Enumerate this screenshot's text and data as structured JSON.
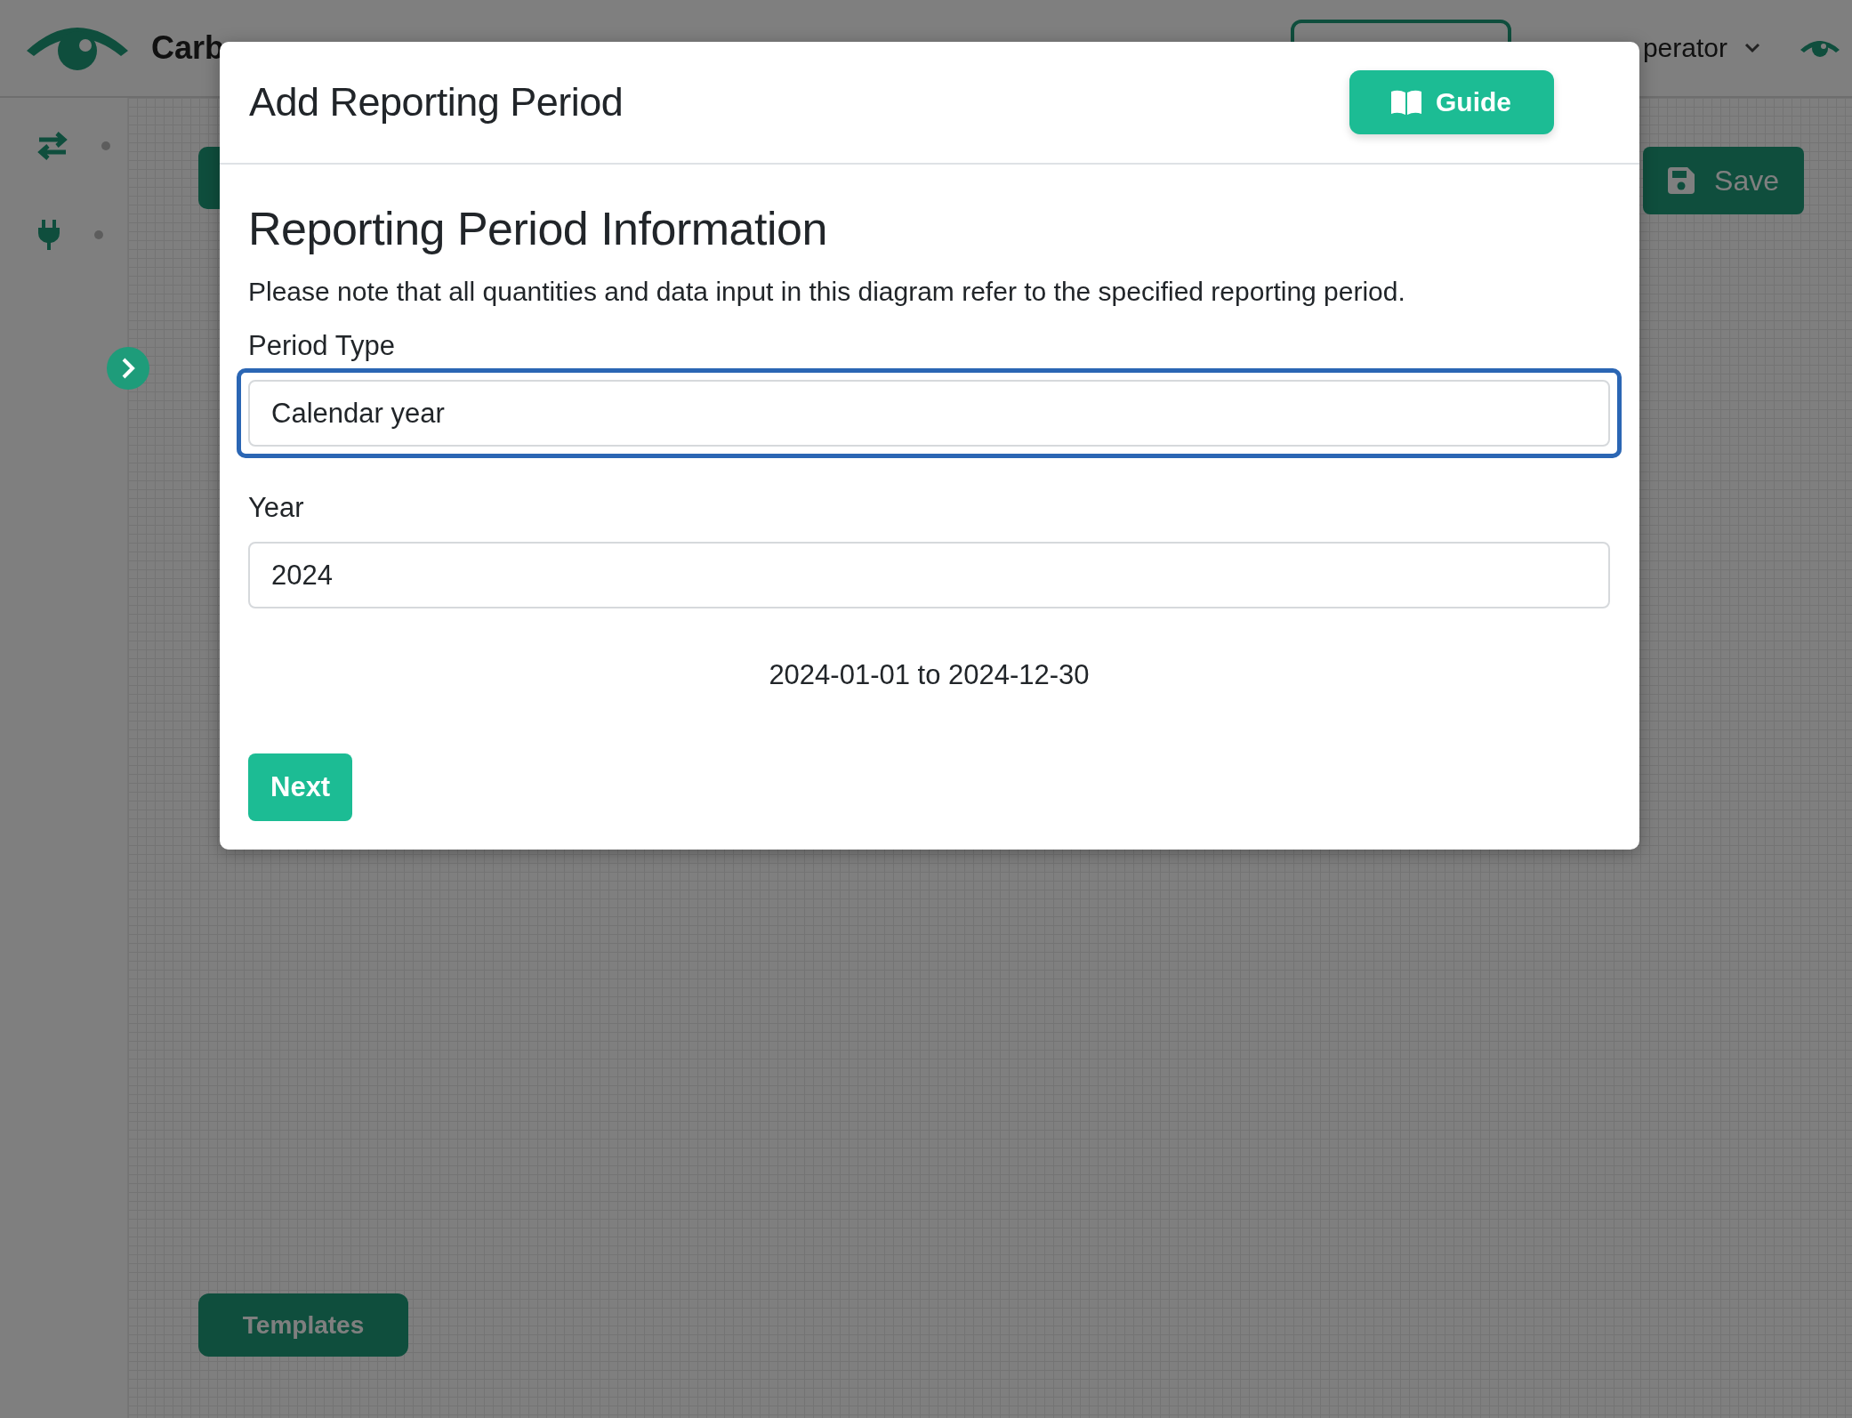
{
  "header": {
    "brand": "Carb",
    "user": "perator"
  },
  "canvas": {
    "save_button": "Save",
    "templates_button": "Templates"
  },
  "modal": {
    "title": "Add Reporting Period",
    "guide_button": "Guide",
    "section_title": "Reporting Period Information",
    "note": "Please note that all quantities and data input in this diagram refer to the specified reporting period.",
    "fields": [
      {
        "label": "Period Type",
        "value": "Calendar year",
        "focused": true
      },
      {
        "label": "Year",
        "value": "2024",
        "focused": false
      }
    ],
    "date_range": "2024-01-01 to 2024-12-30",
    "next_button": "Next"
  }
}
